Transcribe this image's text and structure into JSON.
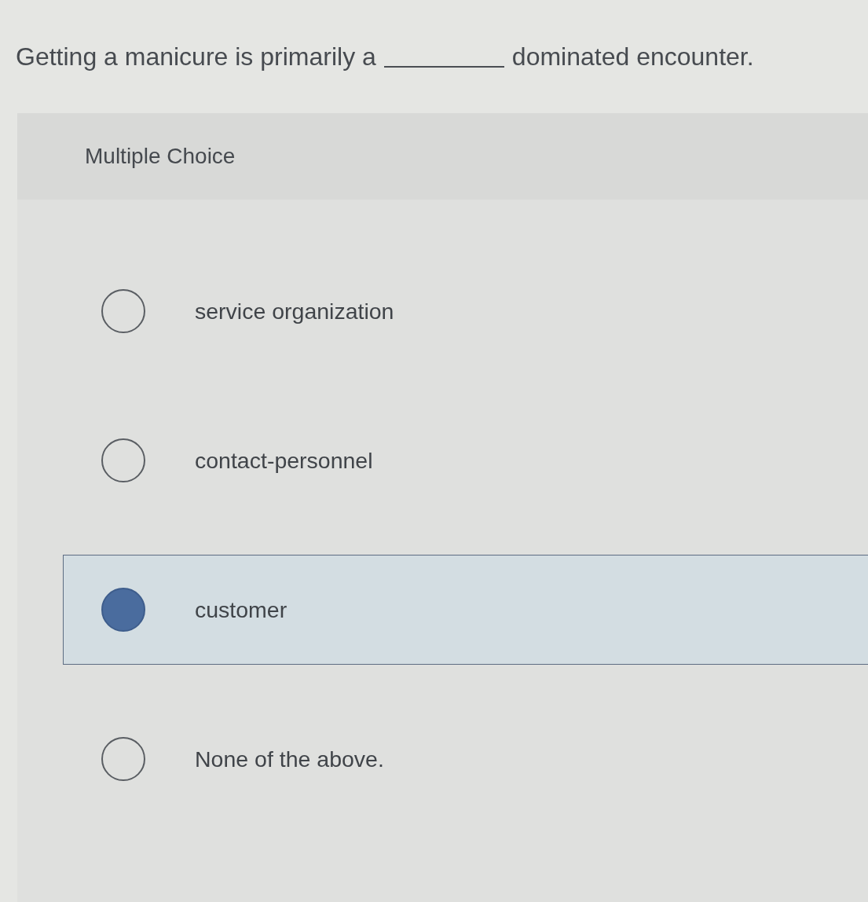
{
  "question": {
    "parts": [
      {
        "kind": "text",
        "text": "Getting a manicure is primarily a"
      },
      {
        "kind": "blank"
      },
      {
        "kind": "text",
        "text": "dominated encounter."
      }
    ]
  },
  "answer_panel": {
    "heading": "Multiple Choice",
    "options": [
      {
        "label": "service organization",
        "selected": false
      },
      {
        "label": "contact-personnel",
        "selected": false
      },
      {
        "label": "customer",
        "selected": true
      },
      {
        "label": "None of the above.",
        "selected": false
      }
    ]
  }
}
